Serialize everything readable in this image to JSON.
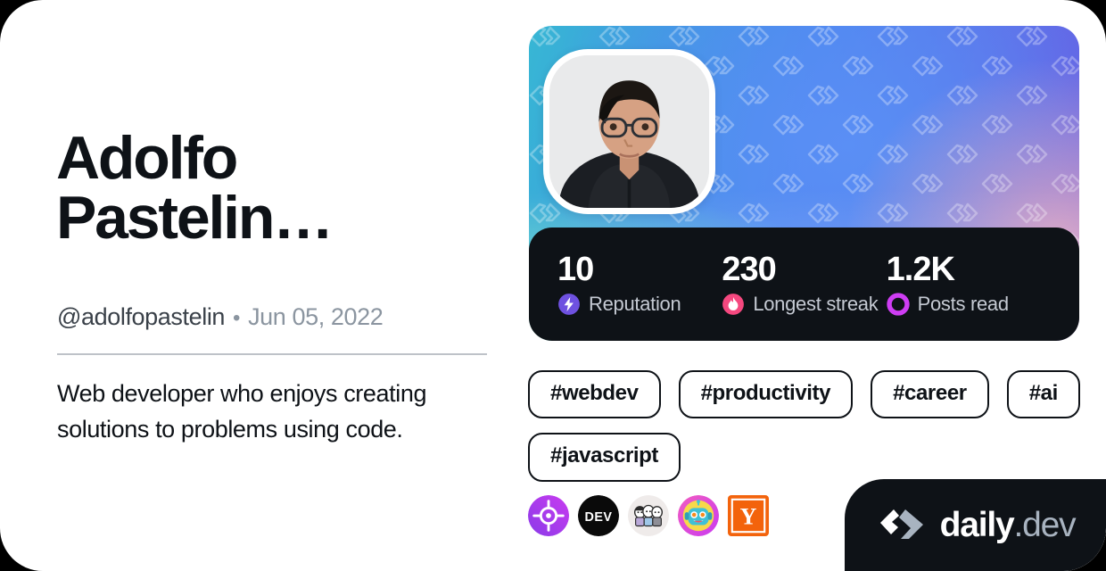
{
  "profile": {
    "display_name": "Adolfo\nPastelin…",
    "handle": "@adolfopastelin",
    "separator": "•",
    "joined_date": "Jun 05, 2022",
    "bio": "Web developer who enjoys creating solutions to problems using code.",
    "avatar_alt": "Adolfo Pastelin profile photo"
  },
  "stats": [
    {
      "value": "10",
      "label": "Reputation",
      "icon": "reputation-bolt-icon",
      "color": "#6E51E0"
    },
    {
      "value": "230",
      "label": "Longest streak",
      "icon": "streak-flame-icon",
      "color": "#F5487F"
    },
    {
      "value": "1.2K",
      "label": "Posts read",
      "icon": "posts-read-ring-icon",
      "color": "#CE3DF3"
    }
  ],
  "tags": [
    {
      "label": "#webdev"
    },
    {
      "label": "#productivity"
    },
    {
      "label": "#career"
    },
    {
      "label": "#ai"
    },
    {
      "label": "#javascript"
    }
  ],
  "sources": [
    {
      "name": "crosshair-target-source-icon"
    },
    {
      "name": "dev-to-source-icon",
      "text": "DEV"
    },
    {
      "name": "characters-source-icon"
    },
    {
      "name": "robot-source-icon"
    },
    {
      "name": "hacker-news-source-icon",
      "text": "Y"
    }
  ],
  "branding": {
    "logo_mark": "daily-dev-logo-mark",
    "name": "daily",
    "tld": ".dev"
  },
  "theme": {
    "card_background": "#FFFFFF",
    "text_primary": "#0E1217",
    "text_secondary": "#3A4149",
    "text_muted": "#8B95A0",
    "divider": "#BEC2C8",
    "dark_surface": "#0E1217"
  }
}
